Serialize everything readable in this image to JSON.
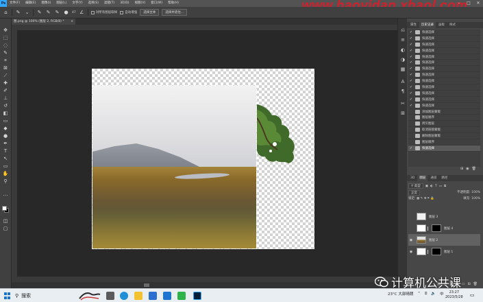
{
  "menubar": {
    "logo": "Ps",
    "items": [
      "文件(F)",
      "编辑(E)",
      "图像(I)",
      "图层(L)",
      "文字(Y)",
      "选择(S)",
      "滤镜(T)",
      "3D(D)",
      "视图(V)",
      "窗口(W)",
      "帮助(H)"
    ],
    "watermark": "www.haoyidan.xhaol.com"
  },
  "options": {
    "brush_size": "47",
    "sample_all_layers": "对所有图层取样",
    "auto_enhance": "自动增强",
    "select_subject": "选择主体",
    "select_and_mask": "选择并遮住..."
  },
  "document": {
    "tab_title": "图.png @ 100% (图层 2, RGB/8) *",
    "close": "×",
    "status": "33.33%"
  },
  "panels": {
    "top_tabs": [
      {
        "label": "属性",
        "active": false
      },
      {
        "label": "历史记录",
        "active": true
      },
      {
        "label": "画板",
        "active": false
      },
      {
        "label": "样式",
        "active": false
      }
    ],
    "history": [
      {
        "label": "快速选择",
        "checked": true,
        "selected": false
      },
      {
        "label": "快速选择",
        "checked": true,
        "selected": false
      },
      {
        "label": "快速选择",
        "checked": true,
        "selected": false
      },
      {
        "label": "快速选择",
        "checked": true,
        "selected": false
      },
      {
        "label": "快速选择",
        "checked": true,
        "selected": false
      },
      {
        "label": "快速选择",
        "checked": true,
        "selected": false
      },
      {
        "label": "快速选择",
        "checked": true,
        "selected": false
      },
      {
        "label": "快速选择",
        "checked": true,
        "selected": false
      },
      {
        "label": "快速选择",
        "checked": true,
        "selected": false
      },
      {
        "label": "快速选择",
        "checked": true,
        "selected": false
      },
      {
        "label": "快速选择",
        "checked": true,
        "selected": false
      },
      {
        "label": "快速选择",
        "checked": true,
        "selected": false
      },
      {
        "label": "快速选择",
        "checked": true,
        "selected": false
      },
      {
        "label": "添加图层蒙版",
        "checked": false,
        "selected": false
      },
      {
        "label": "图层顺序",
        "checked": false,
        "selected": false
      },
      {
        "label": "拷贝图层",
        "checked": false,
        "selected": false
      },
      {
        "label": "取消链接蒙版",
        "checked": false,
        "selected": false
      },
      {
        "label": "删除图层蒙版",
        "checked": false,
        "selected": false
      },
      {
        "label": "图层顺序",
        "checked": false,
        "selected": false
      },
      {
        "label": "快速选择",
        "checked": true,
        "selected": true
      }
    ],
    "layer_tabs": [
      {
        "label": "图层",
        "active": true
      },
      {
        "label": "通道",
        "active": false
      },
      {
        "label": "路径",
        "active": false
      }
    ],
    "filter_kind": "类型",
    "blend_mode": "正常",
    "opacity_label": "不透明度:",
    "opacity_value": "100%",
    "lock_label": "锁定:",
    "fill_label": "填充:",
    "fill_value": "100%",
    "layers": [
      {
        "name": "图层 3",
        "visible": false,
        "has_mask": false,
        "selected": false
      },
      {
        "name": "图层 4",
        "visible": false,
        "has_mask": true,
        "selected": false
      },
      {
        "name": "图层 2",
        "visible": true,
        "has_mask": false,
        "selected": true
      },
      {
        "name": "图层 1",
        "visible": true,
        "has_mask": true,
        "selected": false
      }
    ]
  },
  "wechat": {
    "text": "计算机公共课"
  },
  "taskbar": {
    "search": "搜索",
    "weather": "23°C 大部晴朗",
    "ime": "中",
    "time": "23:27",
    "date": "2023/5/28"
  },
  "colors": {
    "accent": "#31a8ff",
    "watermark": "#d21f2c",
    "canvas_bg": "#282828"
  }
}
